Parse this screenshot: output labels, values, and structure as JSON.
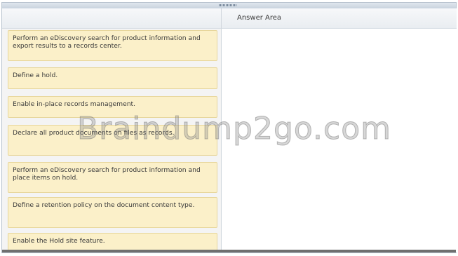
{
  "answer_area": {
    "title": "Answer Area"
  },
  "actions": [
    {
      "label": "Perform an eDiscovery search for product information and export results to a records center."
    },
    {
      "label": "Define a hold."
    },
    {
      "label": "Enable in-place records management."
    },
    {
      "label": "Declare all product documents on files as records."
    },
    {
      "label": "Perform an eDiscovery search for product information and place items on hold."
    },
    {
      "label": "Define a retention policy on the document content type."
    },
    {
      "label": "Enable the Hold site feature."
    }
  ],
  "watermark": {
    "text": "Braindump2go.com"
  }
}
